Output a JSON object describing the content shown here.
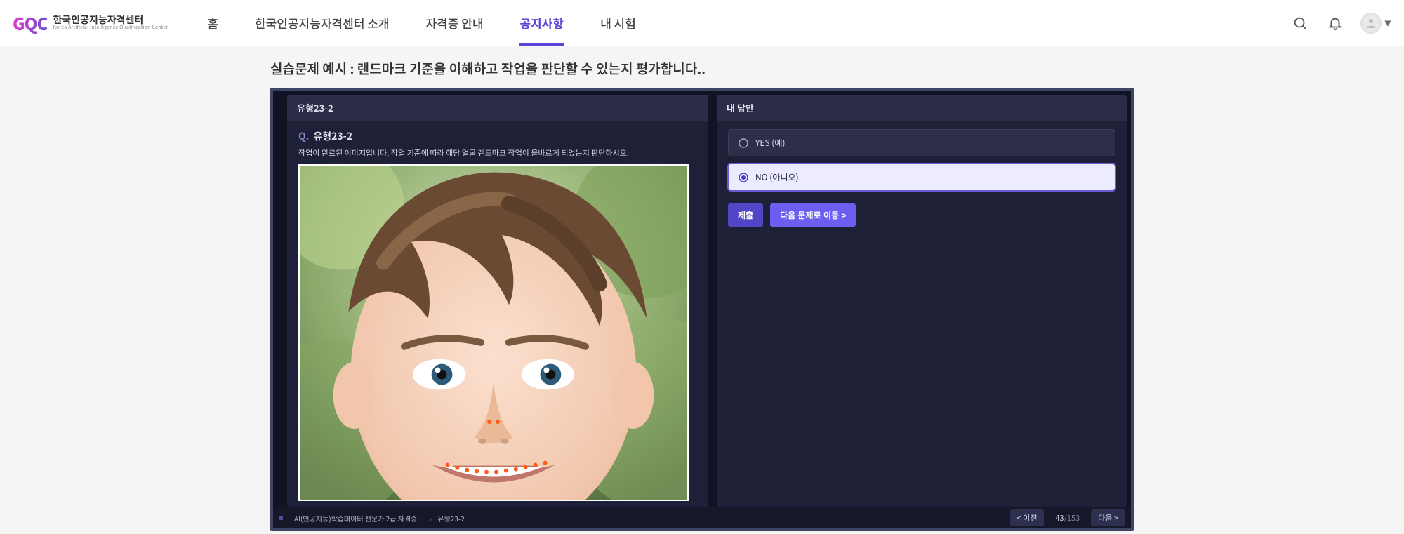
{
  "site": {
    "logo_mark": "GQC",
    "logo_kr": "한국인공지능자격센터",
    "logo_en": "Korea Artificial Intelligence Qualification Center"
  },
  "nav": {
    "items": [
      {
        "label": "홈"
      },
      {
        "label": "한국인공지능자격센터 소개"
      },
      {
        "label": "자격증 안내"
      },
      {
        "label": "공지사항",
        "active": true
      },
      {
        "label": "내 시험"
      }
    ]
  },
  "page": {
    "title": "실습문제 예시 : 랜드마크 기준을 이해하고 작업을 판단할 수 있는지 평가합니다.."
  },
  "exam": {
    "left_header": "유형23-2",
    "right_header": "내 답안",
    "question": {
      "prefix": "Q.",
      "title": "유형23-2",
      "desc": "작업이 완료된 이미지입니다. 작업 기준에 따라 해당 얼굴 랜드마크 작업이 올바르게 되었는지 판단하시오."
    },
    "options": [
      {
        "label": "YES (예)",
        "selected": false
      },
      {
        "label": "NO (아니오)",
        "selected": true
      }
    ],
    "buttons": {
      "submit": "제출",
      "next": "다음 문제로 이동 >"
    },
    "footer": {
      "breadcrumb": [
        "AI(인공지능)학습데이터 전문가 2급 자격증…",
        "유형23-2"
      ],
      "prev": "< 이전",
      "next": "다음 >",
      "progress_current": "43",
      "progress_total": "/153"
    }
  }
}
